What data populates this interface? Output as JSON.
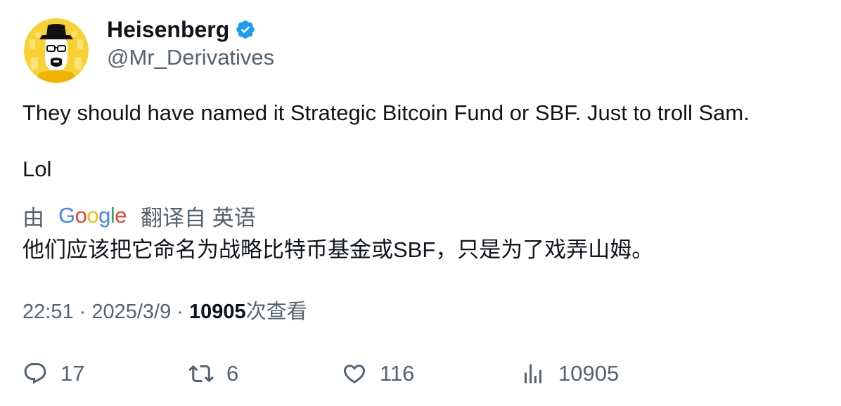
{
  "author": {
    "display_name": "Heisenberg",
    "handle": "@Mr_Derivatives",
    "verified_icon": "verified-badge-icon",
    "avatar_icon": "heisenberg-avatar",
    "verified_color": "#1d9bf0"
  },
  "tweet": {
    "line1": "They should have named it Strategic Bitcoin Fund or SBF. Just to troll Sam.",
    "line2": "Lol"
  },
  "translation": {
    "prefix": "由",
    "suffix": "翻译自 英语",
    "text": "他们应该把它命名为战略比特币基金或SBF，只是为了戏弄山姆。"
  },
  "google_logo": {
    "G": "G",
    "o1": "o",
    "o2": "o",
    "g": "g",
    "l": "l",
    "e": "e"
  },
  "meta": {
    "time": "22:51",
    "sep1": " · ",
    "date": "2025/3/9",
    "sep2": " · ",
    "views_count": "10905",
    "views_label": "次查看"
  },
  "actions": {
    "reply_count": "17",
    "repost_count": "6",
    "like_count": "116",
    "views_count": "10905"
  },
  "colors": {
    "text": "#0f1419",
    "secondary": "#536471",
    "avatar_bg": "#f5c518"
  }
}
